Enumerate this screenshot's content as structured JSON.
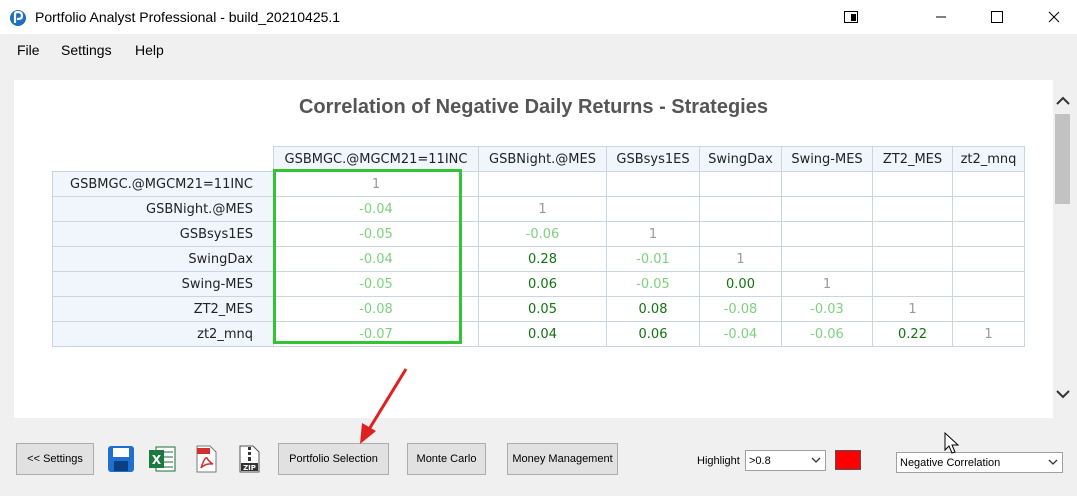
{
  "window": {
    "title": "Portfolio Analyst Professional - build_20210425.1"
  },
  "menu": {
    "items": [
      "File",
      "Settings",
      "Help"
    ]
  },
  "report": {
    "title": "Correlation of Negative Daily Returns - Strategies",
    "columns": [
      "GSBMGC.@MGCM21=11INC",
      "GSBNight.@MES",
      "GSBsys1ES",
      "SwingDax",
      "Swing-MES",
      "ZT2_MES",
      "zt2_mnq"
    ],
    "rows": [
      {
        "label": "GSBMGC.@MGCM21=11INC",
        "cells": [
          [
            "1",
            "one"
          ],
          [
            "",
            ""
          ],
          [
            "",
            ""
          ],
          [
            "",
            ""
          ],
          [
            "",
            ""
          ],
          [
            "",
            ""
          ],
          [
            "",
            ""
          ]
        ]
      },
      {
        "label": "GSBNight.@MES",
        "cells": [
          [
            "-0.04",
            "light"
          ],
          [
            "1",
            "one"
          ],
          [
            "",
            ""
          ],
          [
            "",
            ""
          ],
          [
            "",
            ""
          ],
          [
            "",
            ""
          ],
          [
            "",
            ""
          ]
        ]
      },
      {
        "label": "GSBsys1ES",
        "cells": [
          [
            "-0.05",
            "light"
          ],
          [
            "-0.06",
            "light"
          ],
          [
            "1",
            "one"
          ],
          [
            "",
            ""
          ],
          [
            "",
            ""
          ],
          [
            "",
            ""
          ],
          [
            "",
            ""
          ]
        ]
      },
      {
        "label": "SwingDax",
        "cells": [
          [
            "-0.04",
            "light"
          ],
          [
            "0.28",
            "dark"
          ],
          [
            "-0.01",
            "light"
          ],
          [
            "1",
            "one"
          ],
          [
            "",
            ""
          ],
          [
            "",
            ""
          ],
          [
            "",
            ""
          ]
        ]
      },
      {
        "label": "Swing-MES",
        "cells": [
          [
            "-0.05",
            "light"
          ],
          [
            "0.06",
            "dark"
          ],
          [
            "-0.05",
            "light"
          ],
          [
            "0.00",
            "dark"
          ],
          [
            "1",
            "one"
          ],
          [
            "",
            ""
          ],
          [
            "",
            ""
          ]
        ]
      },
      {
        "label": "ZT2_MES",
        "cells": [
          [
            "-0.08",
            "light"
          ],
          [
            "0.05",
            "dark"
          ],
          [
            "0.08",
            "dark"
          ],
          [
            "-0.08",
            "light"
          ],
          [
            "-0.03",
            "light"
          ],
          [
            "1",
            "one"
          ],
          [
            "",
            ""
          ]
        ]
      },
      {
        "label": "zt2_mnq",
        "cells": [
          [
            "-0.07",
            "light"
          ],
          [
            "0.04",
            "dark"
          ],
          [
            "0.06",
            "dark"
          ],
          [
            "-0.04",
            "light"
          ],
          [
            "-0.06",
            "light"
          ],
          [
            "0.22",
            "dark"
          ],
          [
            "1",
            "one"
          ]
        ]
      }
    ]
  },
  "toolbar": {
    "settings_label": "<< Settings",
    "portfolio_selection_label": "Portfolio Selection",
    "monte_carlo_label": "Monte Carlo",
    "money_management_label": "Money Management",
    "highlight_label": "Highlight",
    "highlight_value": ">0.8",
    "highlight_color": "#ff0000",
    "mode_value": "Negative Correlation"
  },
  "icons": {
    "save": "save-icon",
    "excel": "excel-icon",
    "pdf": "pdf-icon",
    "zip": "zip-icon"
  },
  "colors": {
    "highlight_border": "#33c433",
    "positive_value": "#137313",
    "negative_value": "#7dd17d",
    "annotation_arrow": "#e02020"
  }
}
